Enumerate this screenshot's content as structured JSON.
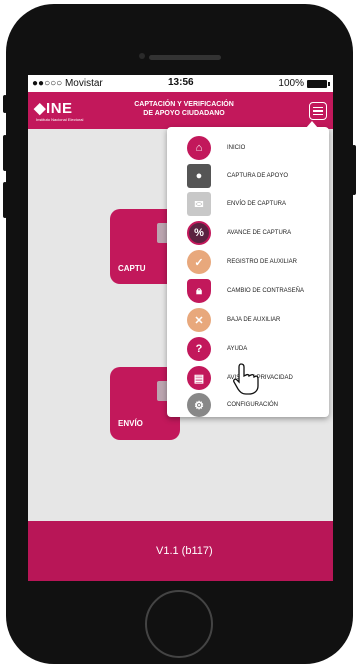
{
  "status_bar": {
    "carrier": "●●○○○ Movistar",
    "time": "13:56",
    "battery": "100%"
  },
  "header": {
    "logo": "INE",
    "logo_sub": "Instituto Nacional Electoral",
    "title_line1": "CAPTACIÓN Y VERIFICACIÓN",
    "title_line2": "DE APOYO CIUDADANO"
  },
  "main": {
    "tile_capture_label": "CAPTU",
    "tile_send_label": "ENVÍO"
  },
  "menu": {
    "items": [
      {
        "label": "INICIO",
        "icon": "home-icon",
        "color": "#c2185b"
      },
      {
        "label": "CAPTURA DE APOYO",
        "icon": "camera-person-icon",
        "color": "#555555"
      },
      {
        "label": "ENVÍO DE CAPTURA",
        "icon": "envelope-icon",
        "color": "#bbbbbb"
      },
      {
        "label": "AVANCE DE CAPTURA",
        "icon": "percent-icon",
        "color": "#5a2240"
      },
      {
        "label": "REGISTRO DE AUXILIAR",
        "icon": "user-check-icon",
        "color": "#e8a87c"
      },
      {
        "label": "CAMBIO DE CONTRASEÑA",
        "icon": "shield-lock-icon",
        "color": "#c2185b"
      },
      {
        "label": "BAJA DE AUXILIAR",
        "icon": "user-remove-icon",
        "color": "#e8a87c"
      },
      {
        "label": "AYUDA",
        "icon": "help-icon",
        "color": "#c2185b"
      },
      {
        "label": "AVISO DE PRIVACIDAD",
        "icon": "document-icon",
        "color": "#c2185b"
      },
      {
        "label": "CONFIGURACIÓN",
        "icon": "gears-icon",
        "color": "#888888"
      }
    ]
  },
  "footer": {
    "version": "V1.1 (b117)"
  },
  "colors": {
    "brand": "#c2185b",
    "background": "#e6e6e6"
  }
}
